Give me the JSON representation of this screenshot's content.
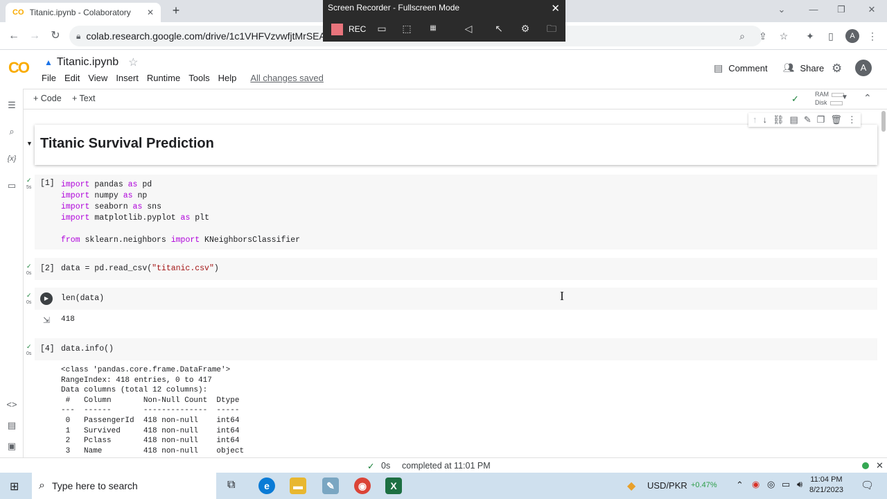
{
  "browser": {
    "tab_title": "Titanic.ipynb - Colaboratory",
    "url": "colab.research.google.com/drive/1c1VHFVzvwfjtMrSEA3q",
    "profile_initial": "A"
  },
  "recorder": {
    "title": "Screen Recorder - Fullscreen Mode",
    "rec_label": "REC"
  },
  "colab": {
    "logo": "CO",
    "notebook_title": "Titanic.ipynb",
    "menu": [
      "File",
      "Edit",
      "View",
      "Insert",
      "Runtime",
      "Tools",
      "Help"
    ],
    "save_status": "All changes saved",
    "comment_label": "Comment",
    "share_label": "Share",
    "avatar_initial": "A",
    "add_code_label": "+ Code",
    "add_text_label": "+ Text",
    "ram_label": "RAM",
    "disk_label": "Disk"
  },
  "notebook": {
    "heading": "Titanic Survival Prediction",
    "cells": [
      {
        "exec_count": "[1]",
        "time": "5s"
      },
      {
        "exec_count": "[2]",
        "time": "0s"
      },
      {
        "exec_count": "",
        "time": "0s"
      },
      {
        "exec_count": "[4]",
        "time": "0s"
      }
    ],
    "cell3_output": "418",
    "cell4_output": "<class 'pandas.core.frame.DataFrame'>\nRangeIndex: 418 entries, 0 to 417\nData columns (total 12 columns):\n #   Column       Non-Null Count  Dtype \n---  ------       --------------  ----- \n 0   PassengerId  418 non-null    int64 \n 1   Survived     418 non-null    int64 \n 2   Pclass       418 non-null    int64 \n 3   Name         418 non-null    object"
  },
  "status": {
    "time": "0s",
    "message": "completed at 11:01 PM"
  },
  "taskbar": {
    "search_placeholder": "Type here to search",
    "ticker": "USD/PKR",
    "ticker_change": "+0.47%",
    "time": "11:04 PM",
    "date": "8/21/2023"
  }
}
